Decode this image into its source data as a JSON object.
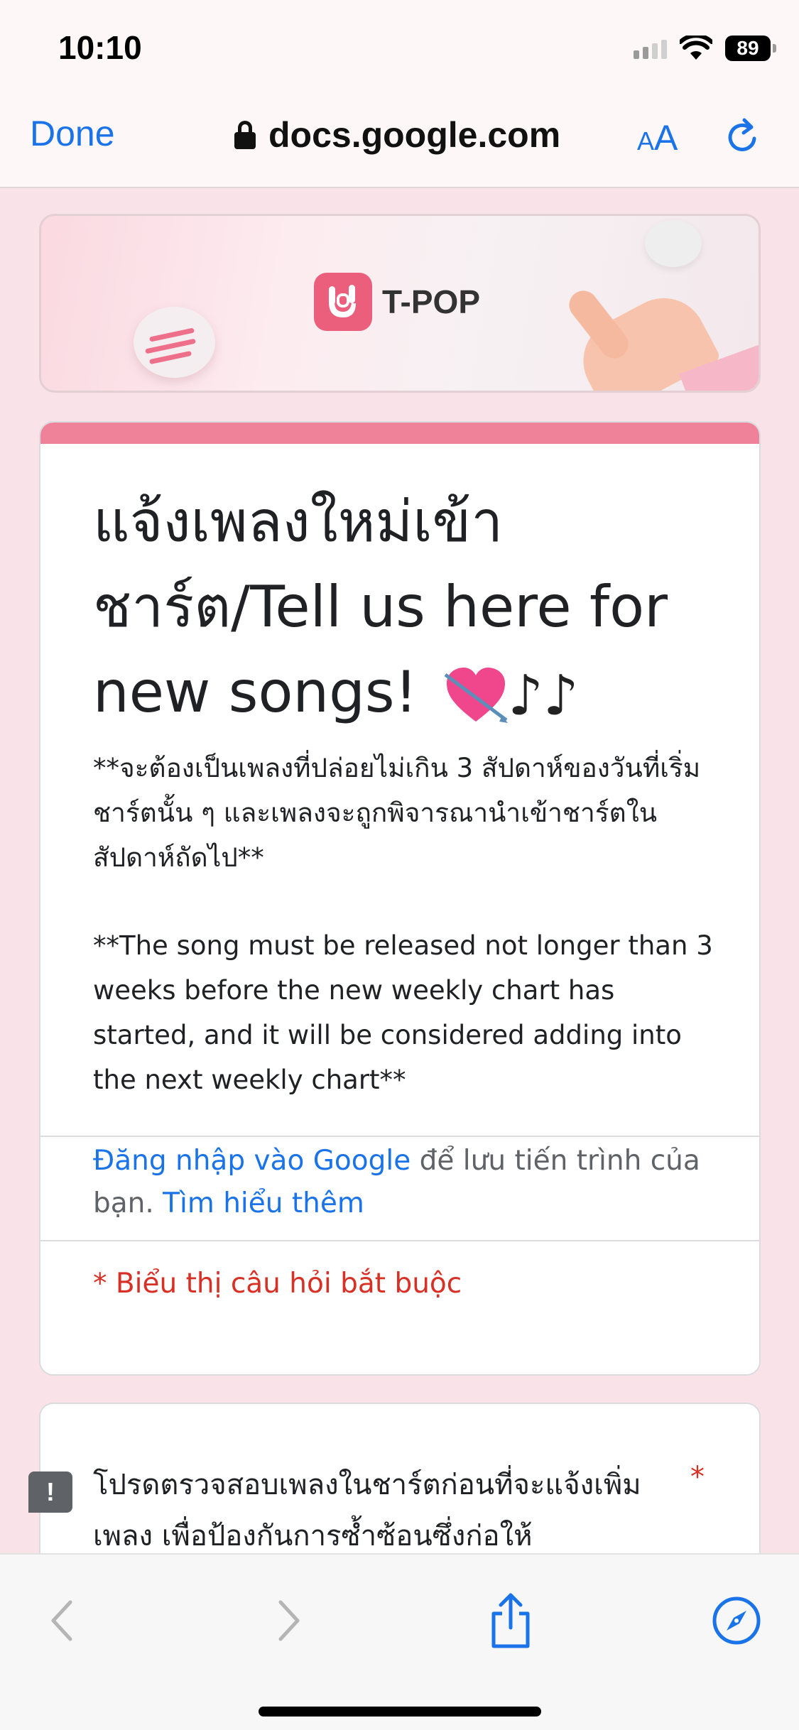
{
  "status_bar": {
    "time": "10:10",
    "battery": "89"
  },
  "browser": {
    "done_label": "Done",
    "url": "docs.google.com",
    "text_size_small": "A",
    "text_size_big": "A"
  },
  "banner": {
    "logo_text": "T-POP"
  },
  "form": {
    "title": "แจ้งเพลงใหม่เข้าชาร์ต/Tell us here for new songs!",
    "title_emoji_notes": "♪♪",
    "description_th": "**จะต้องเป็นเพลงที่ปล่อยไม่เกิน 3 สัปดาห์ของวันที่เริ่มชาร์ตนั้น ๆ และเพลงจะถูกพิจารณานำเข้าชาร์ตในสัปดาห์ถัดไป**",
    "description_en": "**The song must be released not longer than 3 weeks before the new weekly chart has started, and it will be considered adding into the next weekly chart**",
    "signin_link": "Đăng nhập vào Google",
    "signin_text": " để lưu tiến trình của bạn. ",
    "learn_more": "Tìm hiểu thêm",
    "required_note": "* Biểu thị câu hỏi bắt buộc"
  },
  "question": {
    "text": "โปรดตรวจสอบเพลงในชาร์ตก่อนที่จะแจ้งเพิ่มเพลง เพื่อป้องกันการซ้ำซ้อนซึ่งก่อให้",
    "required_marker": "*"
  },
  "feedback": {
    "label": "!"
  },
  "colors": {
    "accent": "#ef8298",
    "link": "#1a73e8",
    "required": "#d93025",
    "background": "#fae3e8"
  }
}
